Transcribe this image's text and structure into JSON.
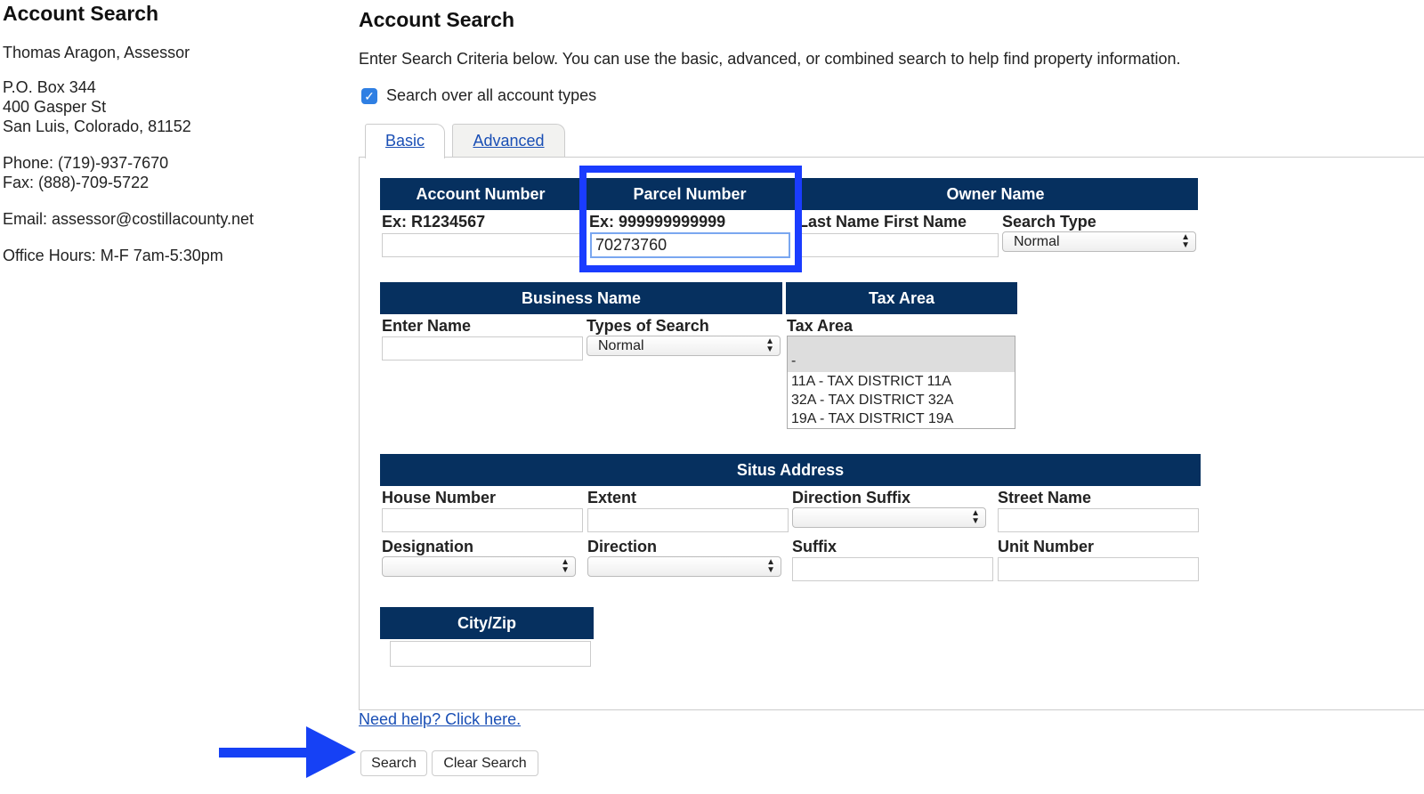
{
  "sidebar": {
    "title": "Account Search",
    "assessor": "Thomas Aragon, Assessor",
    "address": [
      "P.O. Box 344",
      "400 Gasper St",
      "San Luis, Colorado, 81152"
    ],
    "phone": "Phone: (719)-937-7670",
    "fax": "Fax: (888)-709-5722",
    "email": "Email: assessor@costillacounty.net",
    "hours": "Office Hours: M-F 7am-5:30pm"
  },
  "main": {
    "title": "Account Search",
    "intro": "Enter Search Criteria below. You can use the basic, advanced, or combined search to help find property information.",
    "all_types_label": "Search over all account types",
    "all_types_checked": true,
    "tabs": [
      "Basic",
      "Advanced"
    ],
    "account": {
      "header": "Account Number",
      "example": "Ex: R1234567",
      "value": ""
    },
    "parcel": {
      "header": "Parcel Number",
      "example": "Ex: 999999999999",
      "value": "70273760"
    },
    "owner": {
      "header": "Owner Name",
      "name_label": "Last Name First Name",
      "type_label": "Search Type",
      "type_value": "Normal"
    },
    "business": {
      "header": "Business Name",
      "name_label": "Enter Name",
      "type_label": "Types of Search",
      "type_value": "Normal"
    },
    "tax": {
      "header": "Tax Area",
      "label": "Tax Area",
      "options": [
        "-",
        "11A - TAX DISTRICT 11A",
        "32A - TAX DISTRICT 32A",
        "19A - TAX DISTRICT 19A"
      ]
    },
    "situs": {
      "header": "Situs Address",
      "house": "House Number",
      "extent": "Extent",
      "dir_suffix": "Direction Suffix",
      "street": "Street Name",
      "designation": "Designation",
      "direction": "Direction",
      "suffix": "Suffix",
      "unit": "Unit Number"
    },
    "cityzip": {
      "header": "City/Zip"
    },
    "help": "Need help? Click here.",
    "search": "Search",
    "clear": "Clear Search"
  }
}
